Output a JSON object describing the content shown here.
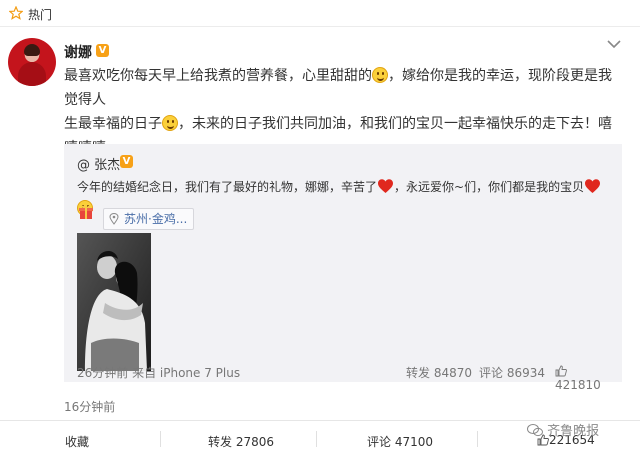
{
  "topbar": {
    "label": "热门",
    "icon": "star-icon"
  },
  "post": {
    "author": "谢娜",
    "badge": "V",
    "text_line1a": "最喜欢吃你每天早上给我煮的营养餐，心里甜甜的",
    "text_line1b": "，嫁给你是我的幸运，现阶段更是我觉得人",
    "text_line2a": "生最幸福的日子",
    "text_line2b": "，未来的日子我们共同加油，和我们的宝贝一起幸福快乐的走下去！嘻嘻嘻嘻",
    "time": "16分钟前"
  },
  "repost": {
    "author": "@ 张杰",
    "badge": "V",
    "text_a": "今年的结婚纪念日，我们有了最好的礼物，娜娜，辛苦了",
    "text_b": "，永远爱你~们，你们都是我的宝贝",
    "location": "苏州·金鸡...",
    "time_source": "26分钟前 来自 iPhone 7 Plus",
    "repost_count": "转发 84870",
    "comment_count": "评论 86934",
    "like_count": "421810"
  },
  "actions": {
    "favorite": "收藏",
    "repost": "转发 27806",
    "comment": "评论 47100",
    "like": "221654"
  },
  "watermark": {
    "text": "齐鲁晚报"
  },
  "colors": {
    "badge": "#f7a117",
    "link": "#4a6ea8",
    "repost_bg": "#f2f2f5"
  }
}
